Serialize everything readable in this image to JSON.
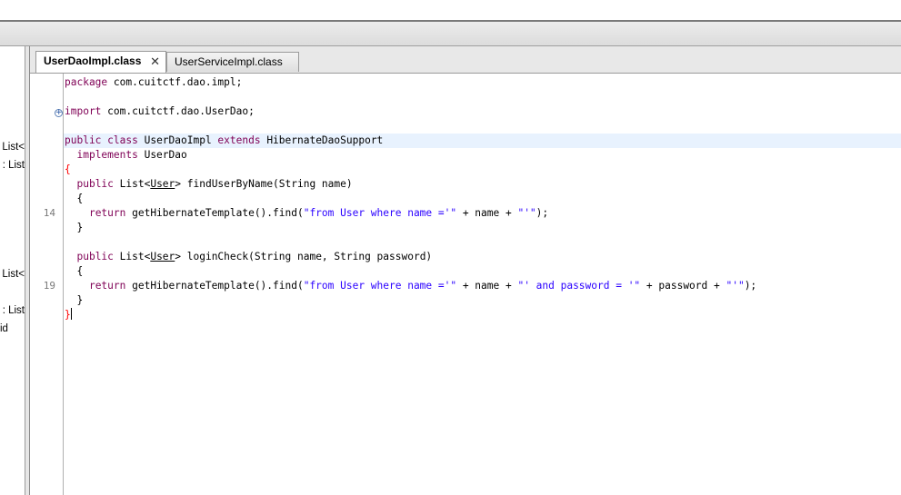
{
  "editor": {
    "tabs": [
      {
        "label": "UserDaoImpl.class",
        "active": true,
        "close_icon": "close-icon"
      },
      {
        "label": "UserServiceImpl.class",
        "active": false
      }
    ]
  },
  "left_panel": {
    "fragments": [
      "List<",
      ": List",
      "List<",
      ": List",
      "id"
    ]
  },
  "code": {
    "lines": {
      "l1_kw": "package",
      "l1_rest": " com.cuitctf.dao.impl;",
      "l3_kw": "import",
      "l3_rest": " com.cuitctf.dao.UserDao;",
      "l5_kw1": "public",
      "l5_kw2": "class",
      "l5_name": " UserDaoImpl ",
      "l5_kw3": "extends",
      "l5_rest": " HibernateDaoSupport",
      "l6_kw": "implements",
      "l6_rest": " UserDao",
      "l7": "{",
      "l8_kw": "public",
      "l8_a": " List<",
      "l8_u": "User",
      "l8_b": "> findUserByName(String name)",
      "l9": "{",
      "l10_kw": "return",
      "l10_a": " getHibernateTemplate().find(",
      "l10_s1": "\"from User where name ='\"",
      "l10_b": " + name + ",
      "l10_s2": "\"'\"",
      "l10_c": ");",
      "l11": "}",
      "l13_kw": "public",
      "l13_a": " List<",
      "l13_u": "User",
      "l13_b": "> loginCheck(String name, String password)",
      "l14": "{",
      "l15_kw": "return",
      "l15_a": " getHibernateTemplate().find(",
      "l15_s1": "\"from User where name ='\"",
      "l15_b": " + name + ",
      "l15_s2": "\"' and password = '\"",
      "l15_c": " + password + ",
      "l15_s3": "\"'\"",
      "l15_d": ");",
      "l16": "}",
      "l17": "}"
    },
    "line_numbers": {
      "a": "14",
      "b": "19"
    },
    "fold_marker": "+"
  },
  "colors": {
    "keyword": "#7f0055",
    "string": "#2a00ff",
    "current_line": "#e8f2fe",
    "brace_match": "#ff0000"
  }
}
